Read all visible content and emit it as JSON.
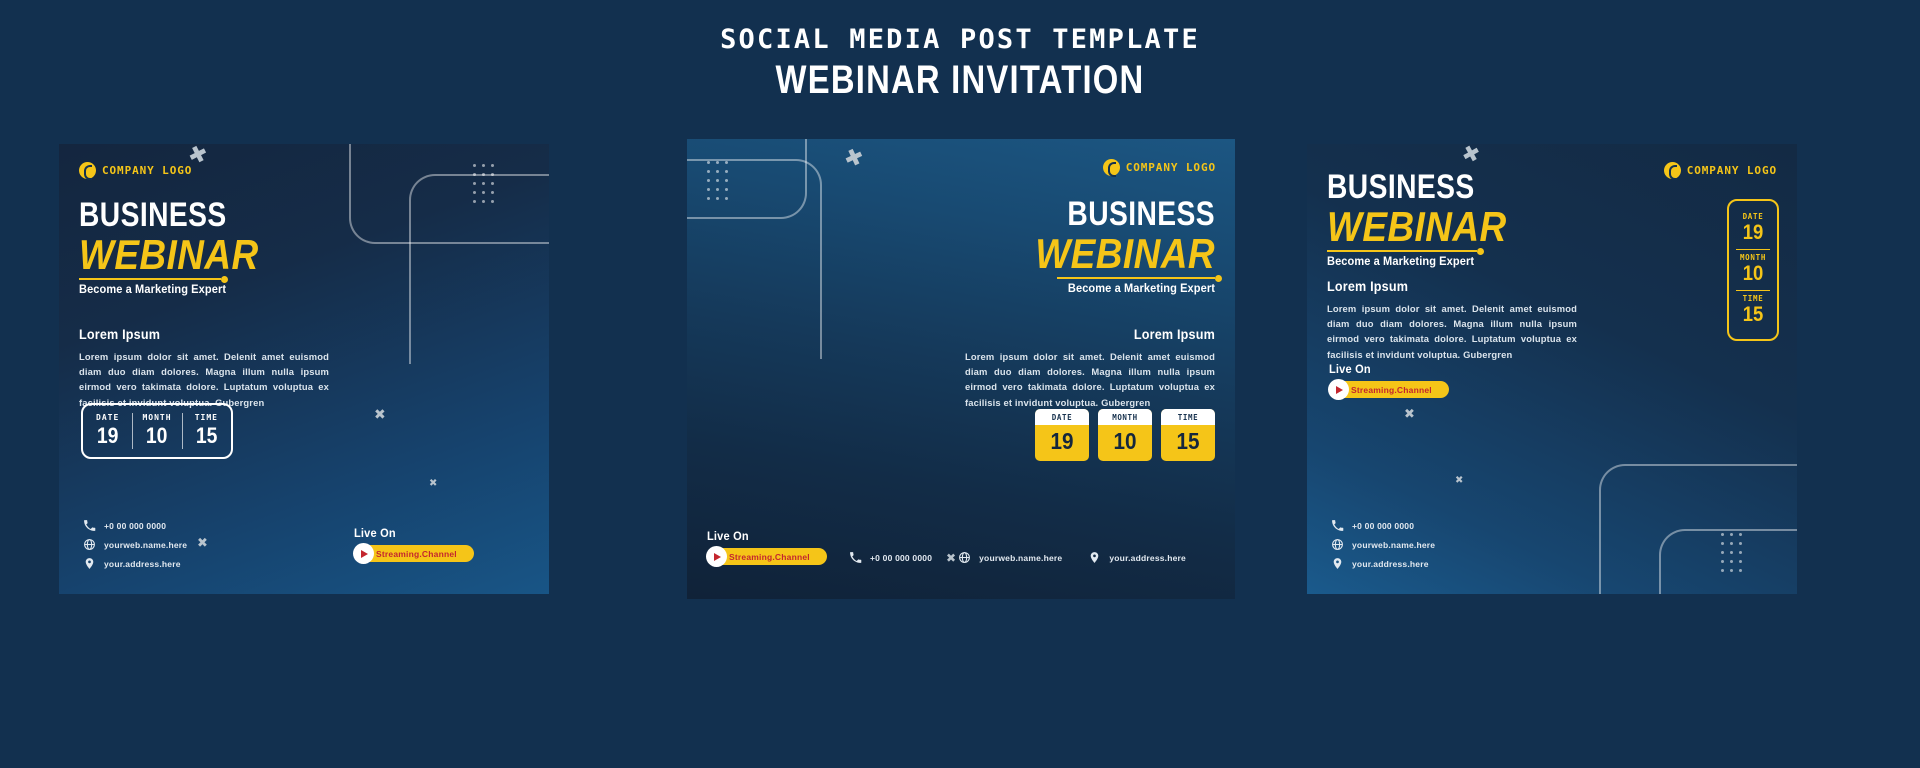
{
  "header": {
    "line1": "SOCIAL MEDIA POST TEMPLATE",
    "line2": "WEBINAR INVITATION"
  },
  "colors": {
    "page_bg": "#12304f",
    "accent_yellow": "#f5c518",
    "play_red": "#c4262e",
    "text_white": "#ffffff"
  },
  "brand": {
    "logo_text": "COMPANY LOGO",
    "logo_icon": "circle-logo-icon"
  },
  "headline": {
    "line1": "BUSINESS",
    "line2": "WEBINAR",
    "tagline": "Become a Marketing Expert"
  },
  "copy": {
    "title": "Lorem Ipsum",
    "body": "Lorem ipsum dolor sit amet. Delenit amet euismod diam duo diam dolores. Magna illum nulla ipsum eirmod vero takimata dolore. Luptatum voluptua ex facilisis et invidunt voluptua. Gubergren"
  },
  "schedule": {
    "items": [
      {
        "label": "DATE",
        "value": "19"
      },
      {
        "label": "MONTH",
        "value": "10"
      },
      {
        "label": "TIME",
        "value": "15"
      }
    ]
  },
  "live": {
    "label": "Live On",
    "channel": "Streaming.Channel",
    "play_icon": "play-icon"
  },
  "contacts": [
    {
      "icon": "phone-icon",
      "text": "+0 00 000 0000"
    },
    {
      "icon": "globe-icon",
      "text": "yourweb.name.here"
    },
    {
      "icon": "pin-icon",
      "text": "your.address.here"
    }
  ],
  "cards": [
    {
      "id": "card-1",
      "name": "post-variant-left"
    },
    {
      "id": "card-2",
      "name": "post-variant-center"
    },
    {
      "id": "card-3",
      "name": "post-variant-right"
    }
  ]
}
